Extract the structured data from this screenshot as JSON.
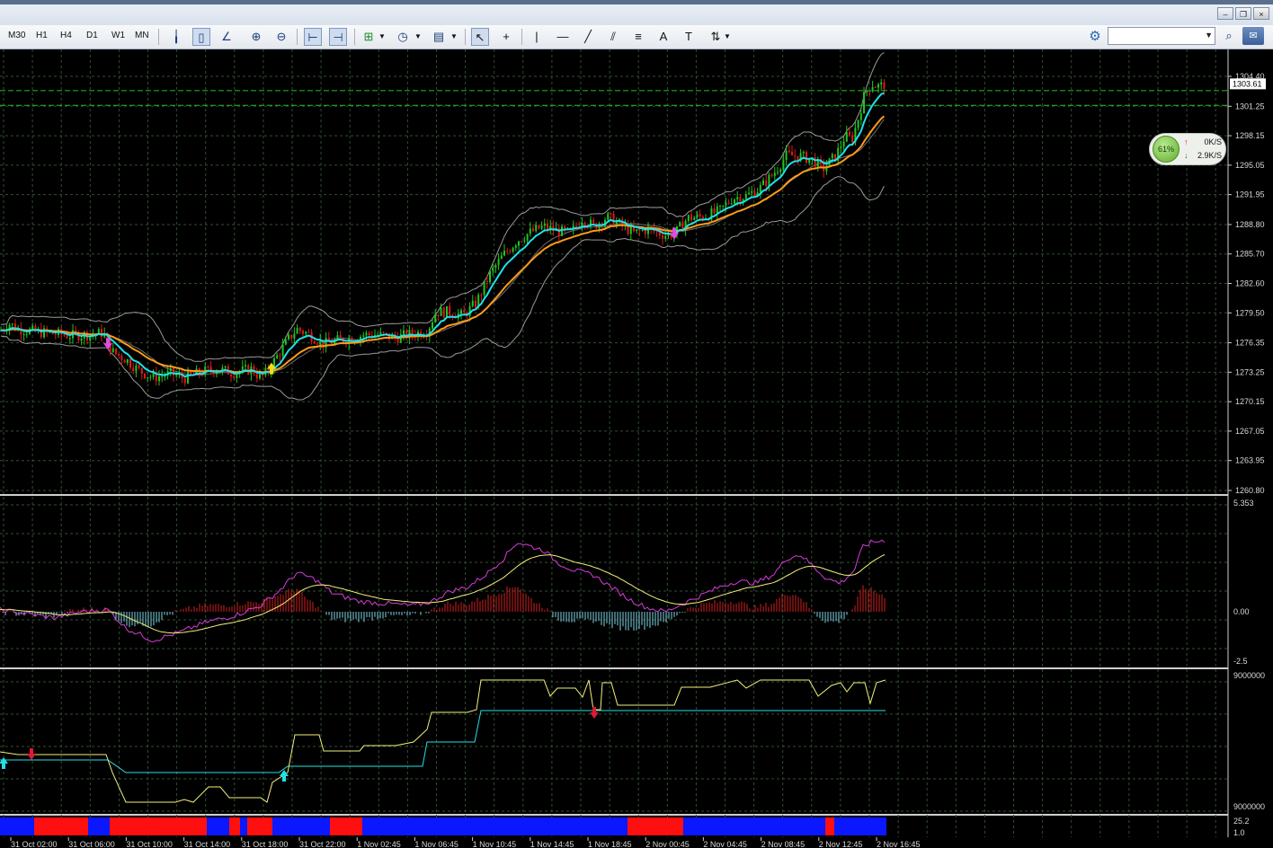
{
  "toolbar": {
    "timeframes": [
      "M30",
      "H1",
      "H4",
      "D1",
      "W1",
      "MN"
    ],
    "icons": [
      "bar-chart-icon",
      "candlestick-icon",
      "line-chart-icon",
      "zoom-in-icon",
      "zoom-out-icon",
      "autoscroll-icon",
      "chart-shift-icon",
      "indicators-icon",
      "periods-icon",
      "templates-icon",
      "cursor-icon",
      "crosshair-icon",
      "vertical-line-icon",
      "horizontal-line-icon",
      "trendline-icon",
      "equidistant-channel-icon",
      "fibonacci-icon",
      "text-icon",
      "text-label-icon",
      "arrows-icon"
    ]
  },
  "window_buttons": [
    "–",
    "❐",
    "×"
  ],
  "net_monitor": {
    "percent": "61%",
    "upload": "0K/S",
    "download": "2.9K/S"
  },
  "colors": {
    "background": "#000000",
    "grid": "#2f4f2f",
    "candle_up": "#1fc51f",
    "candle_down": "#e01818",
    "ema_fast": "#22e0e8",
    "ema_slow": "#ff9a1a",
    "bands": "#9a9a9a",
    "level_line": "#22c322",
    "macd_signal": "#f2f07a",
    "macd_line": "#d83bd8",
    "hist_up": "#d32020",
    "hist_down": "#7fd6e8"
  },
  "price_panel": {
    "axis_labels": [
      "1304.40",
      "1301.25",
      "1298.15",
      "1295.05",
      "1291.95",
      "1288.80",
      "1285.70",
      "1282.60",
      "1279.50",
      "1276.35",
      "1273.25",
      "1270.15",
      "1267.05",
      "1263.95",
      "1260.80"
    ],
    "current_price": "1303.61",
    "level_lines": [
      1302.9,
      1301.35
    ]
  },
  "macd_panel": {
    "axis_labels": [
      "5.353",
      "0.00",
      "-2.5"
    ]
  },
  "third_panel": {
    "axis_labels": [
      "9000000",
      "9000000"
    ]
  },
  "bar_panel": {
    "axis_labels": [
      "25.2",
      "1.0"
    ]
  },
  "time_labels": [
    "31 Oct 02:00",
    "31 Oct 06:00",
    "31 Oct 10:00",
    "31 Oct 14:00",
    "31 Oct 18:00",
    "31 Oct 22:00",
    "1 Nov 02:45",
    "1 Nov 06:45",
    "1 Nov 10:45",
    "1 Nov 14:45",
    "1 Nov 18:45",
    "2 Nov 00:45",
    "2 Nov 04:45",
    "2 Nov 08:45",
    "2 Nov 12:45",
    "2 Nov 16:45"
  ],
  "chart_data": {
    "type": "candlestick",
    "price_path": [
      [
        0,
        1277.6
      ],
      [
        10,
        1278.4
      ],
      [
        20,
        1277.8
      ],
      [
        40,
        1277.5
      ],
      [
        60,
        1277.3
      ],
      [
        80,
        1277.1
      ],
      [
        100,
        1277.2
      ],
      [
        115,
        1277.4
      ],
      [
        125,
        1275.4
      ],
      [
        140,
        1274.6
      ],
      [
        155,
        1273.4
      ],
      [
        170,
        1272.7
      ],
      [
        190,
        1273.1
      ],
      [
        205,
        1272.6
      ],
      [
        225,
        1273.3
      ],
      [
        240,
        1273.6
      ],
      [
        260,
        1273.2
      ],
      [
        280,
        1273.6
      ],
      [
        290,
        1272.6
      ],
      [
        300,
        1273.6
      ],
      [
        310,
        1275.2
      ],
      [
        320,
        1276.6
      ],
      [
        330,
        1277.8
      ],
      [
        345,
        1277.2
      ],
      [
        360,
        1276.2
      ],
      [
        375,
        1276.6
      ],
      [
        390,
        1276.8
      ],
      [
        405,
        1277.2
      ],
      [
        420,
        1277.2
      ],
      [
        440,
        1276.9
      ],
      [
        460,
        1277.3
      ],
      [
        475,
        1277.6
      ],
      [
        485,
        1279.6
      ],
      [
        500,
        1279.6
      ],
      [
        515,
        1279.2
      ],
      [
        530,
        1280.6
      ],
      [
        545,
        1283.6
      ],
      [
        560,
        1285.6
      ],
      [
        575,
        1287.1
      ],
      [
        590,
        1288.0
      ],
      [
        605,
        1288.6
      ],
      [
        620,
        1288.1
      ],
      [
        635,
        1287.9
      ],
      [
        648,
        1289.5
      ],
      [
        660,
        1288.6
      ],
      [
        675,
        1289.6
      ],
      [
        690,
        1288.8
      ],
      [
        705,
        1287.9
      ],
      [
        720,
        1288.3
      ],
      [
        740,
        1287.7
      ],
      [
        752,
        1288.0
      ],
      [
        765,
        1289.5
      ],
      [
        780,
        1289.6
      ],
      [
        800,
        1290.2
      ],
      [
        815,
        1291.6
      ],
      [
        830,
        1291.8
      ],
      [
        845,
        1292.6
      ],
      [
        860,
        1294.1
      ],
      [
        875,
        1296.1
      ],
      [
        890,
        1296.0
      ],
      [
        905,
        1295.6
      ],
      [
        915,
        1294.6
      ],
      [
        930,
        1296.1
      ],
      [
        940,
        1298.1
      ],
      [
        948,
        1297.8
      ],
      [
        955,
        1300.1
      ],
      [
        962,
        1302.6
      ],
      [
        970,
        1303.6
      ],
      [
        978,
        1303.3
      ],
      [
        985,
        1303.6
      ]
    ],
    "macd_path": [
      [
        0,
        0.1
      ],
      [
        30,
        -0.1
      ],
      [
        60,
        -0.3
      ],
      [
        90,
        0.0
      ],
      [
        120,
        0.1
      ],
      [
        140,
        -0.8
      ],
      [
        170,
        -1.4
      ],
      [
        200,
        -1.0
      ],
      [
        230,
        -0.5
      ],
      [
        260,
        -0.2
      ],
      [
        290,
        0.3
      ],
      [
        310,
        1.0
      ],
      [
        330,
        1.9
      ],
      [
        350,
        1.6
      ],
      [
        370,
        0.9
      ],
      [
        400,
        0.5
      ],
      [
        430,
        0.4
      ],
      [
        460,
        0.3
      ],
      [
        480,
        0.5
      ],
      [
        500,
        1.0
      ],
      [
        520,
        1.2
      ],
      [
        540,
        1.8
      ],
      [
        560,
        2.6
      ],
      [
        575,
        3.4
      ],
      [
        590,
        3.2
      ],
      [
        605,
        3.0
      ],
      [
        620,
        2.4
      ],
      [
        640,
        2.0
      ],
      [
        660,
        1.8
      ],
      [
        680,
        1.2
      ],
      [
        700,
        0.6
      ],
      [
        720,
        0.2
      ],
      [
        740,
        0.0
      ],
      [
        760,
        0.4
      ],
      [
        780,
        0.8
      ],
      [
        800,
        1.2
      ],
      [
        820,
        1.5
      ],
      [
        840,
        1.4
      ],
      [
        860,
        1.8
      ],
      [
        875,
        2.6
      ],
      [
        890,
        2.8
      ],
      [
        905,
        2.2
      ],
      [
        920,
        1.6
      ],
      [
        935,
        1.4
      ],
      [
        950,
        2.0
      ],
      [
        960,
        3.2
      ],
      [
        970,
        3.4
      ],
      [
        985,
        3.5
      ]
    ],
    "bars_segments": [
      [
        "blue",
        0,
        38
      ],
      [
        "red",
        38,
        98
      ],
      [
        "blue",
        98,
        122
      ],
      [
        "red",
        122,
        230
      ],
      [
        "blue",
        230,
        255
      ],
      [
        "red",
        255,
        267
      ],
      [
        "blue",
        267,
        275
      ],
      [
        "red",
        275,
        303
      ],
      [
        "blue",
        303,
        367
      ],
      [
        "red",
        367,
        403
      ],
      [
        "blue",
        403,
        698
      ],
      [
        "red",
        698,
        760
      ],
      [
        "blue",
        760,
        918
      ],
      [
        "red",
        918,
        928
      ],
      [
        "blue",
        928,
        986
      ]
    ]
  }
}
